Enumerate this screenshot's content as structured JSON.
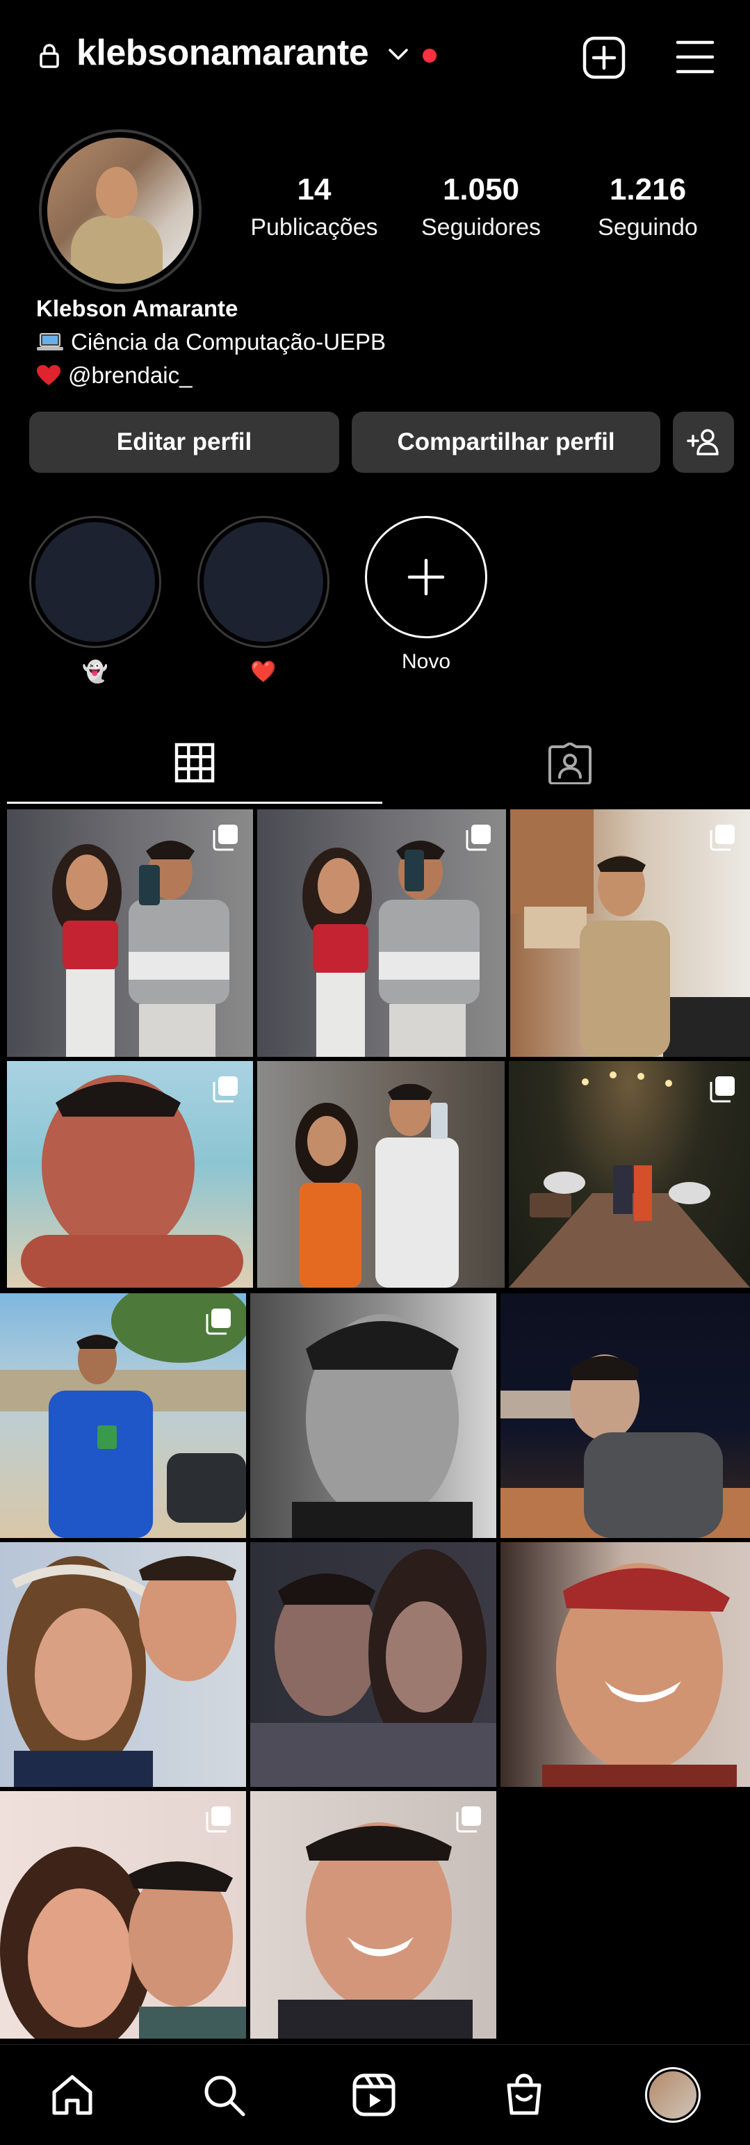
{
  "header": {
    "username": "klebsonamarante",
    "has_notification_dot": true
  },
  "profile": {
    "stats": [
      {
        "value": "14",
        "label": "Publicações"
      },
      {
        "value": "1.050",
        "label": "Seguidores"
      },
      {
        "value": "1.216",
        "label": "Seguindo"
      }
    ],
    "name": "Klebson Amarante",
    "bio_line1": "Ciência da Computação-UEPB",
    "bio_line2": "@brendaic_"
  },
  "actions": {
    "edit_label": "Editar perfil",
    "share_label": "Compartilhar perfil"
  },
  "highlights": [
    {
      "label": "👻"
    },
    {
      "label": "❤️"
    },
    {
      "label": "Novo"
    }
  ],
  "tabs": [
    "grid-icon",
    "tagged-icon"
  ],
  "posts": [
    {
      "type": "couple-mirror-selfie",
      "multi": true
    },
    {
      "type": "couple-mirror-selfie",
      "multi": true
    },
    {
      "type": "portrait-kitchen",
      "multi": true
    },
    {
      "type": "beach-selfie",
      "multi": true
    },
    {
      "type": "couple-mirror-selfie-orange",
      "multi": false
    },
    {
      "type": "couple-night-garden",
      "multi": true
    },
    {
      "type": "italy-jersey-portrait",
      "multi": true
    },
    {
      "type": "bw-portrait",
      "multi": false
    },
    {
      "type": "night-portrait-hoodie",
      "multi": false
    },
    {
      "type": "couple-close-selfie",
      "multi": false
    },
    {
      "type": "couple-close-selfie-dark",
      "multi": false
    },
    {
      "type": "smiling-cap-selfie",
      "multi": false
    },
    {
      "type": "couple-smiling-selfie",
      "multi": true
    },
    {
      "type": "smiling-selfie",
      "multi": true
    }
  ],
  "bottom_nav": [
    "home-icon",
    "search-icon",
    "reels-icon",
    "shop-icon",
    "profile-avatar"
  ],
  "colors": {
    "background": "#000000",
    "button": "#363636",
    "notification": "#ff3040"
  }
}
